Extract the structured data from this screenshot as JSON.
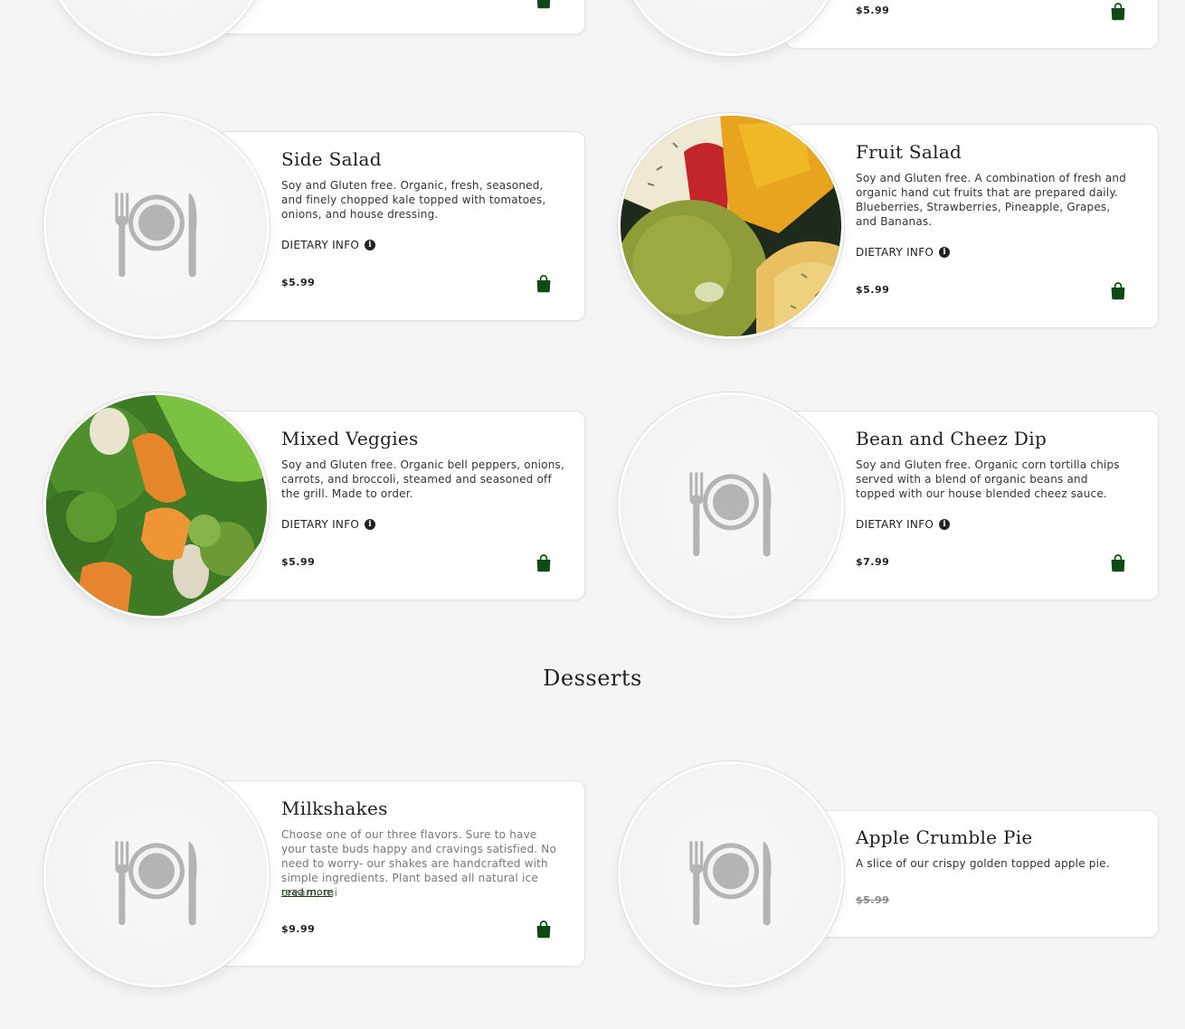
{
  "colors": {
    "page_bg": "#f5f5f5",
    "card_bg": "#ffffff",
    "accent": "#0f4a14",
    "text": "#222222"
  },
  "common": {
    "dietary_label": "DIETARY INFO",
    "info_icon": "i",
    "cart_icon": "shopping-bag-icon",
    "placeholder_icon": "plate-fork-knife-icon"
  },
  "top_partial": {
    "right_price": "$5.99"
  },
  "items": {
    "side_salad": {
      "name": "Side Salad",
      "desc": "Soy and Gluten free. Organic, fresh, seasoned, and finely chopped kale topped with tomatoes, onions, and house dressing.",
      "price": "$5.99"
    },
    "fruit_salad": {
      "name": "Fruit Salad",
      "desc": "Soy and Gluten free. A combination of fresh and organic hand cut fruits that are prepared daily. Blueberries, Strawberries, Pineapple, Grapes, and Bananas.",
      "price": "$5.99"
    },
    "mixed_veggies": {
      "name": "Mixed Veggies",
      "desc": "Soy and Gluten free. Organic bell peppers, onions, carrots, and broccoli, steamed and seasoned off the grill. Made to order.",
      "price": "$5.99"
    },
    "bean_cheez_dip": {
      "name": "Bean and Cheez Dip",
      "desc": "Soy and Gluten free. Organic corn tortilla chips served with a blend of organic beans and topped with our house blended cheez sauce.",
      "price": "$7.99"
    }
  },
  "desserts": {
    "heading": "Desserts",
    "milkshakes": {
      "name": "Milkshakes",
      "desc": "Choose one of our three flavors. Sure to have your taste buds happy and cravings satisfied. No need to worry- our shakes are handcrafted with simple ingredients. Plant based all natural ice cream, mi",
      "read_more": "read more",
      "price": "$9.99"
    },
    "apple_pie": {
      "name": "Apple Crumble Pie",
      "desc": "A slice of our crispy golden topped apple pie.",
      "price": "$5.99"
    }
  }
}
